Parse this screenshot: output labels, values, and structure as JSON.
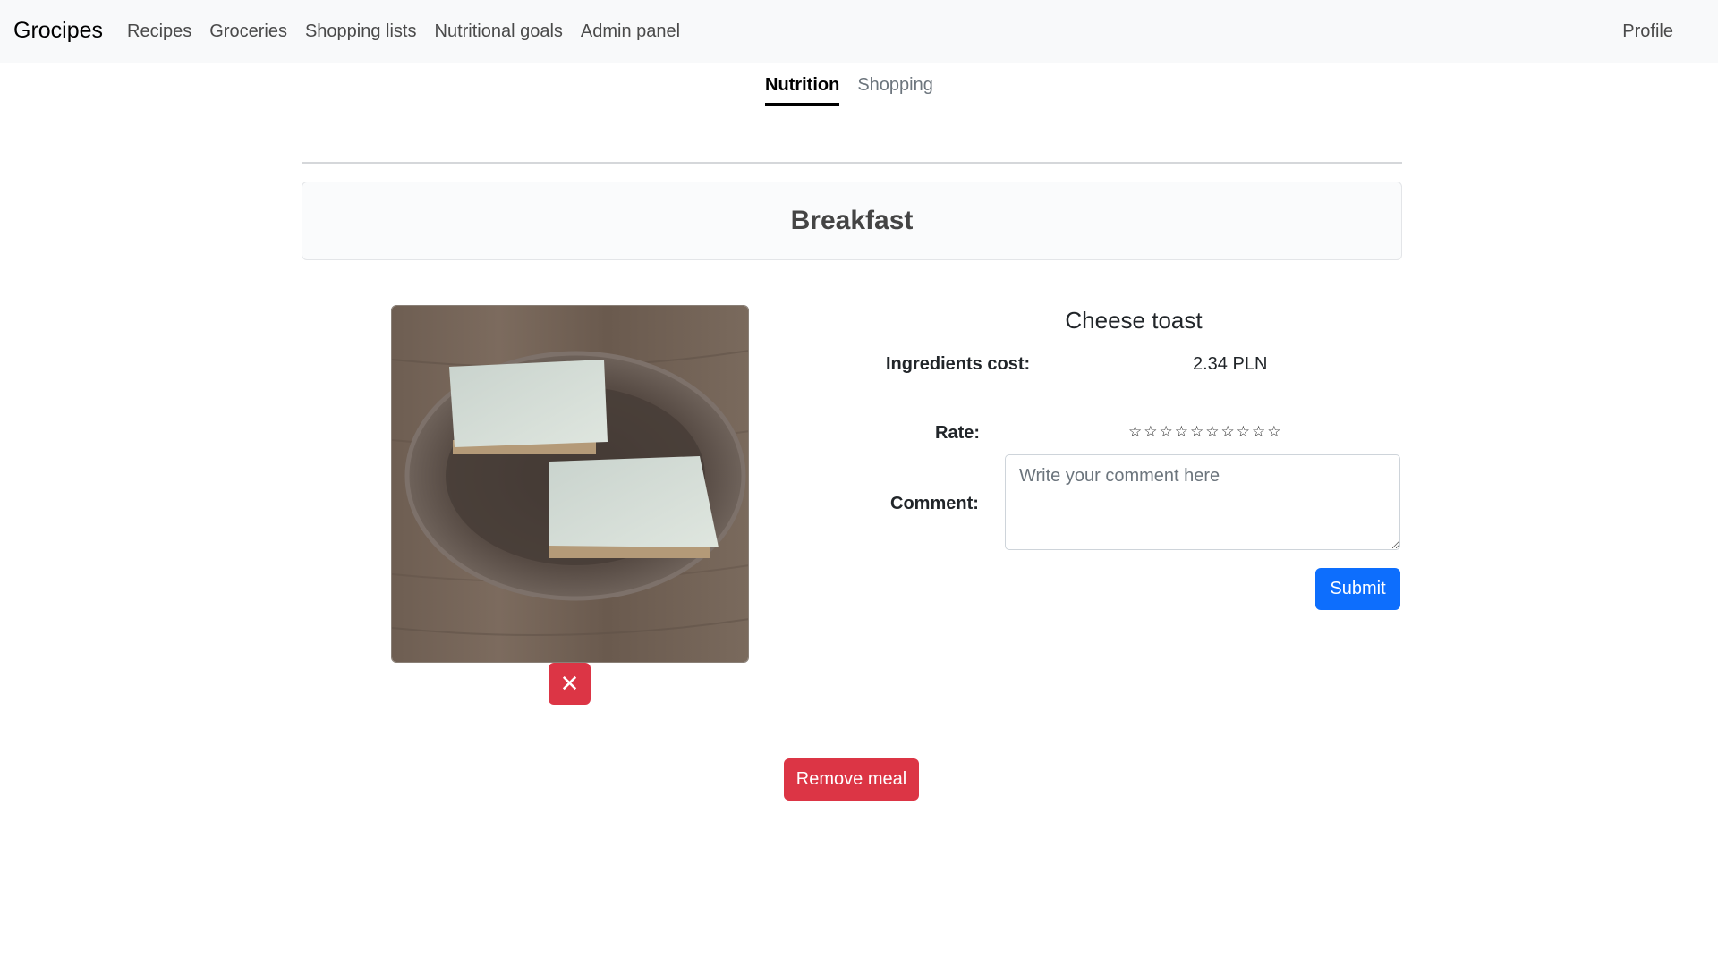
{
  "navbar": {
    "brand": "Grocipes",
    "links": [
      "Recipes",
      "Groceries",
      "Shopping lists",
      "Nutritional goals",
      "Admin panel"
    ],
    "profile": "Profile"
  },
  "subtabs": [
    {
      "label": "Nutrition",
      "active": true
    },
    {
      "label": "Shopping",
      "active": false
    }
  ],
  "meal": {
    "title": "Breakfast",
    "photo_alt": "Cheese toast photo",
    "remove_photo_icon": "close-icon",
    "remove_photo_glyph": "✕"
  },
  "recipe": {
    "name": "Cheese toast",
    "cost_label": "Ingredients cost:",
    "cost_value": "2.34 PLN",
    "rate_label": "Rate:",
    "star_glyph": "☆",
    "max_rating": 10,
    "rating": 0,
    "comment_label": "Comment:",
    "comment_placeholder": "Write your comment here",
    "comment_value": "",
    "submit_label": "Submit"
  },
  "actions": {
    "remove_meal_label": "Remove meal"
  },
  "colors": {
    "primary": "#0d6efd",
    "danger": "#dc3545",
    "navbar_bg": "#f8f9fa"
  }
}
